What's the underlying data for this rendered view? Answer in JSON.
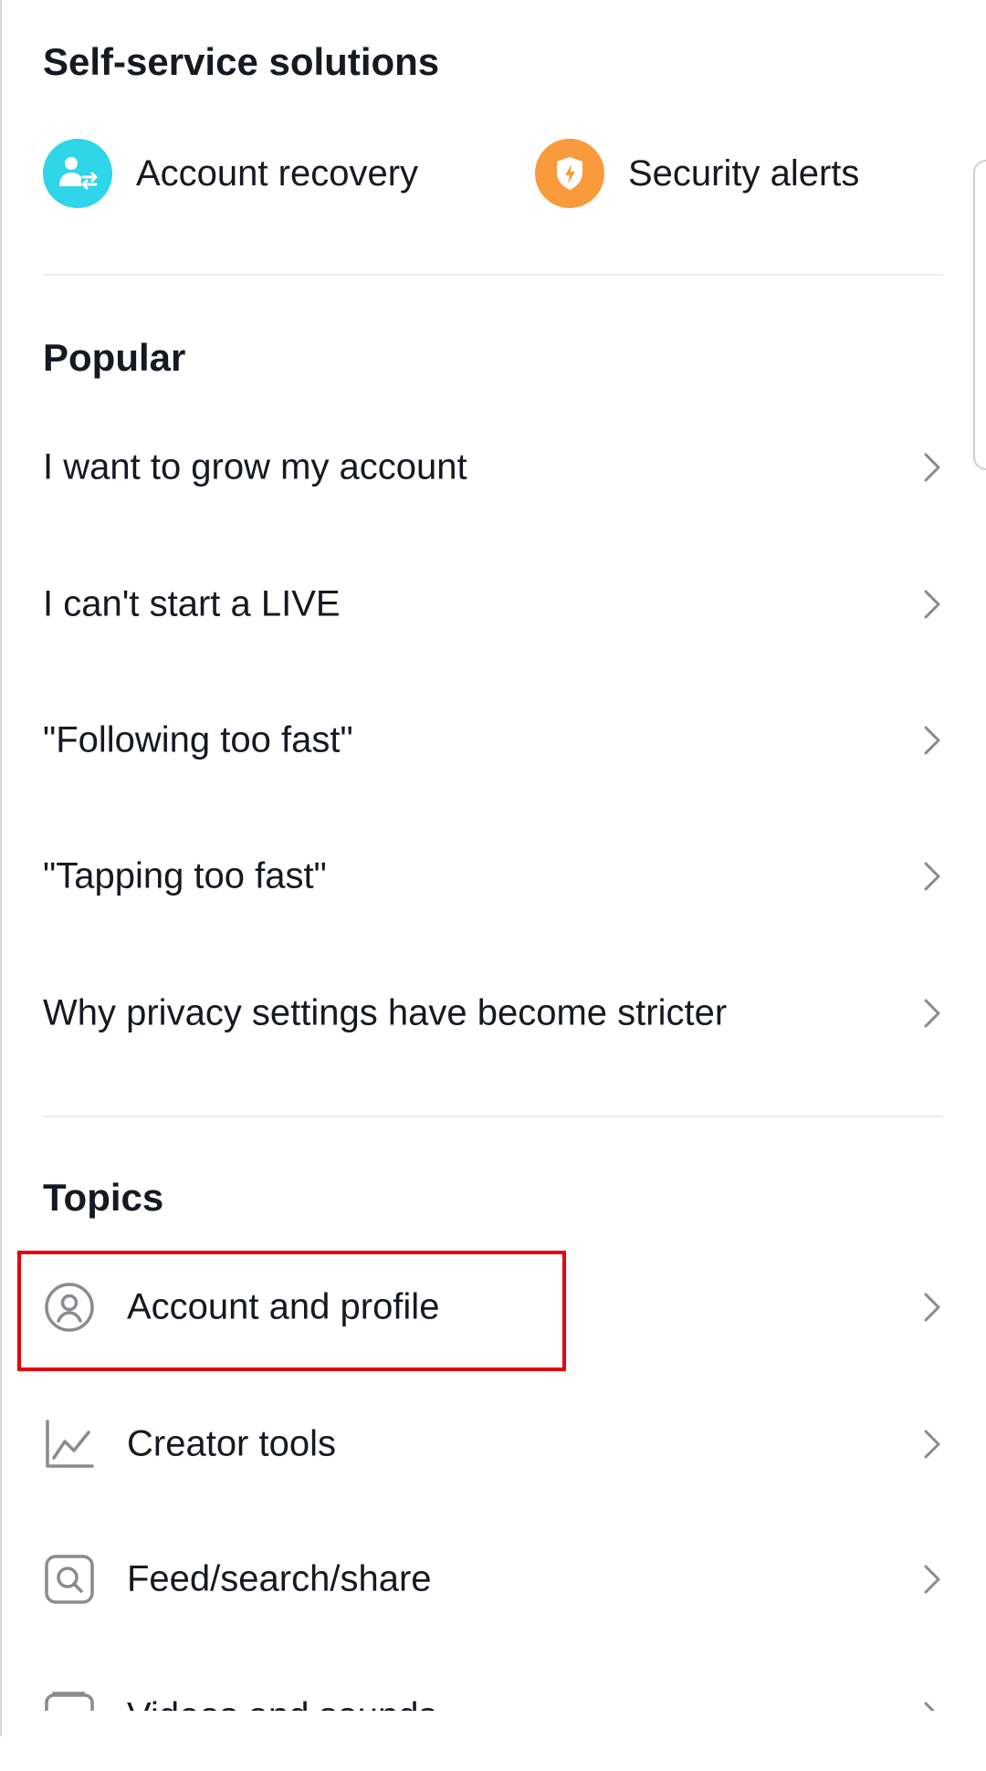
{
  "self_service": {
    "title": "Self-service solutions",
    "items": [
      {
        "label": "Account recovery",
        "icon": "account-recovery-icon",
        "color": "#2fd5e8"
      },
      {
        "label": "Security alerts",
        "icon": "shield-alert-icon",
        "color": "#f99a3c"
      }
    ]
  },
  "popular": {
    "title": "Popular",
    "items": [
      {
        "label": "I want to grow my account"
      },
      {
        "label": "I can't start a LIVE"
      },
      {
        "label": "\"Following too fast\""
      },
      {
        "label": "\"Tapping too fast\""
      },
      {
        "label": "Why privacy settings have become stricter"
      }
    ]
  },
  "topics": {
    "title": "Topics",
    "items": [
      {
        "label": "Account and profile",
        "icon": "user-circle-icon"
      },
      {
        "label": "Creator tools",
        "icon": "line-chart-icon"
      },
      {
        "label": "Feed/search/share",
        "icon": "search-box-icon"
      },
      {
        "label": "Videos and sounds",
        "icon": "video-icon"
      }
    ]
  },
  "highlight_color": "#e8000b"
}
